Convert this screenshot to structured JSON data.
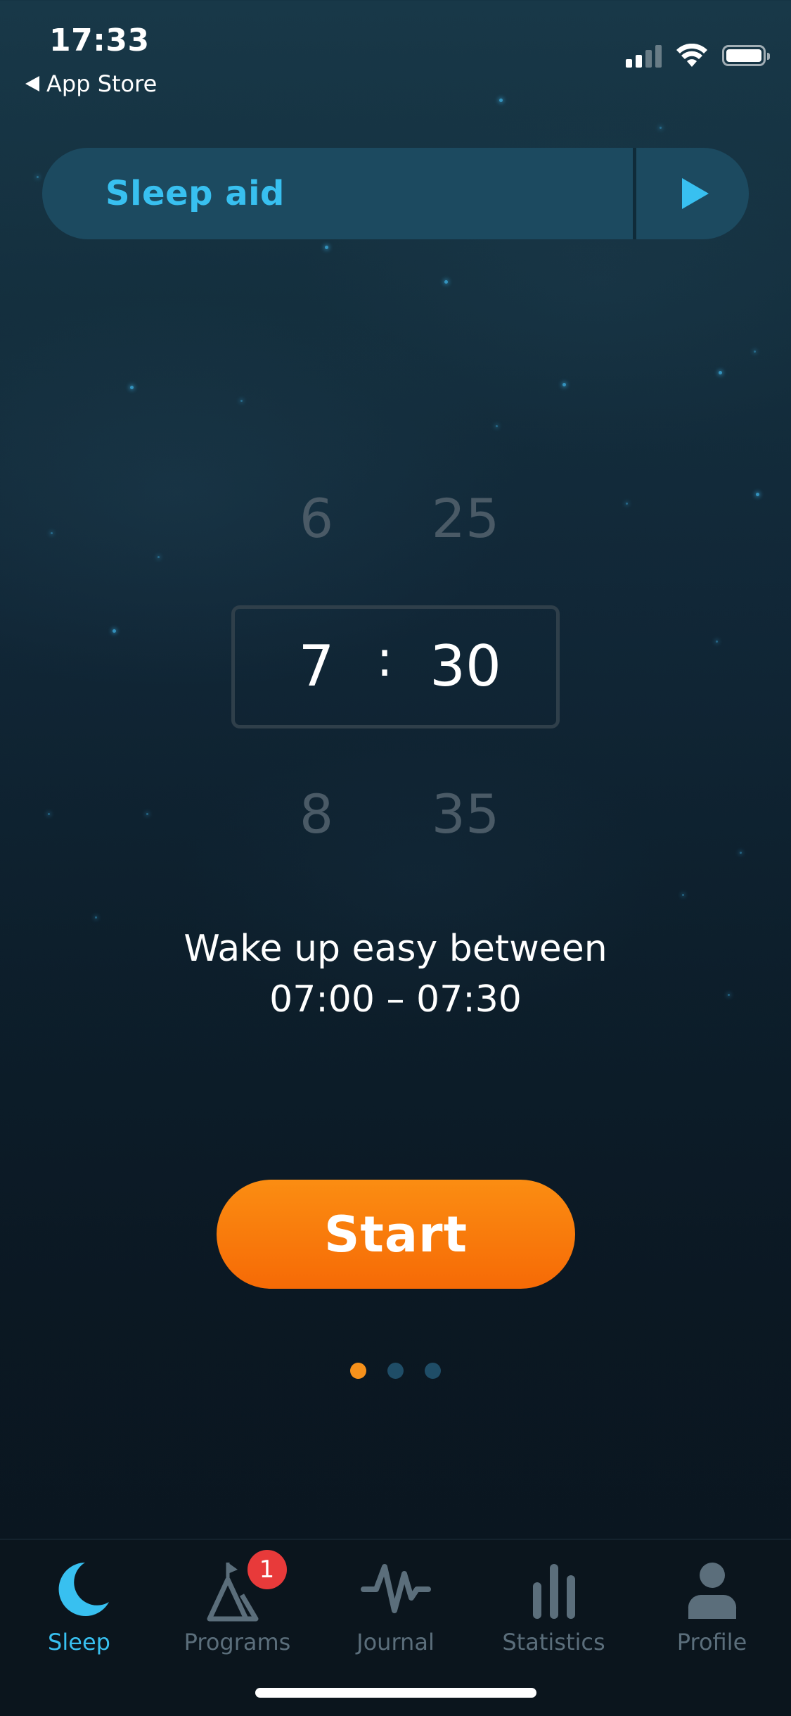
{
  "status_bar": {
    "time": "17:33",
    "back_label": "App Store"
  },
  "sleep_aid": {
    "label": "Sleep aid",
    "play_icon": "play-icon",
    "accent_color": "#38c0f0"
  },
  "time_picker": {
    "hours": {
      "prev": "6",
      "selected": "7",
      "next": "8"
    },
    "minutes": {
      "prev": "25",
      "selected": "30",
      "next": "35"
    },
    "separator": ":"
  },
  "wake_window": {
    "line1": "Wake up easy between",
    "line2": "07:00 – 07:30"
  },
  "start_button": {
    "label": "Start",
    "color": "#f6801a"
  },
  "pager": {
    "count": 3,
    "active_index": 0
  },
  "tabs": [
    {
      "label": "Sleep",
      "icon": "moon-icon",
      "active": true
    },
    {
      "label": "Programs",
      "icon": "programs-icon",
      "badge": "1"
    },
    {
      "label": "Journal",
      "icon": "journal-wave-icon"
    },
    {
      "label": "Statistics",
      "icon": "bar-chart-icon"
    },
    {
      "label": "Profile",
      "icon": "person-icon"
    }
  ]
}
